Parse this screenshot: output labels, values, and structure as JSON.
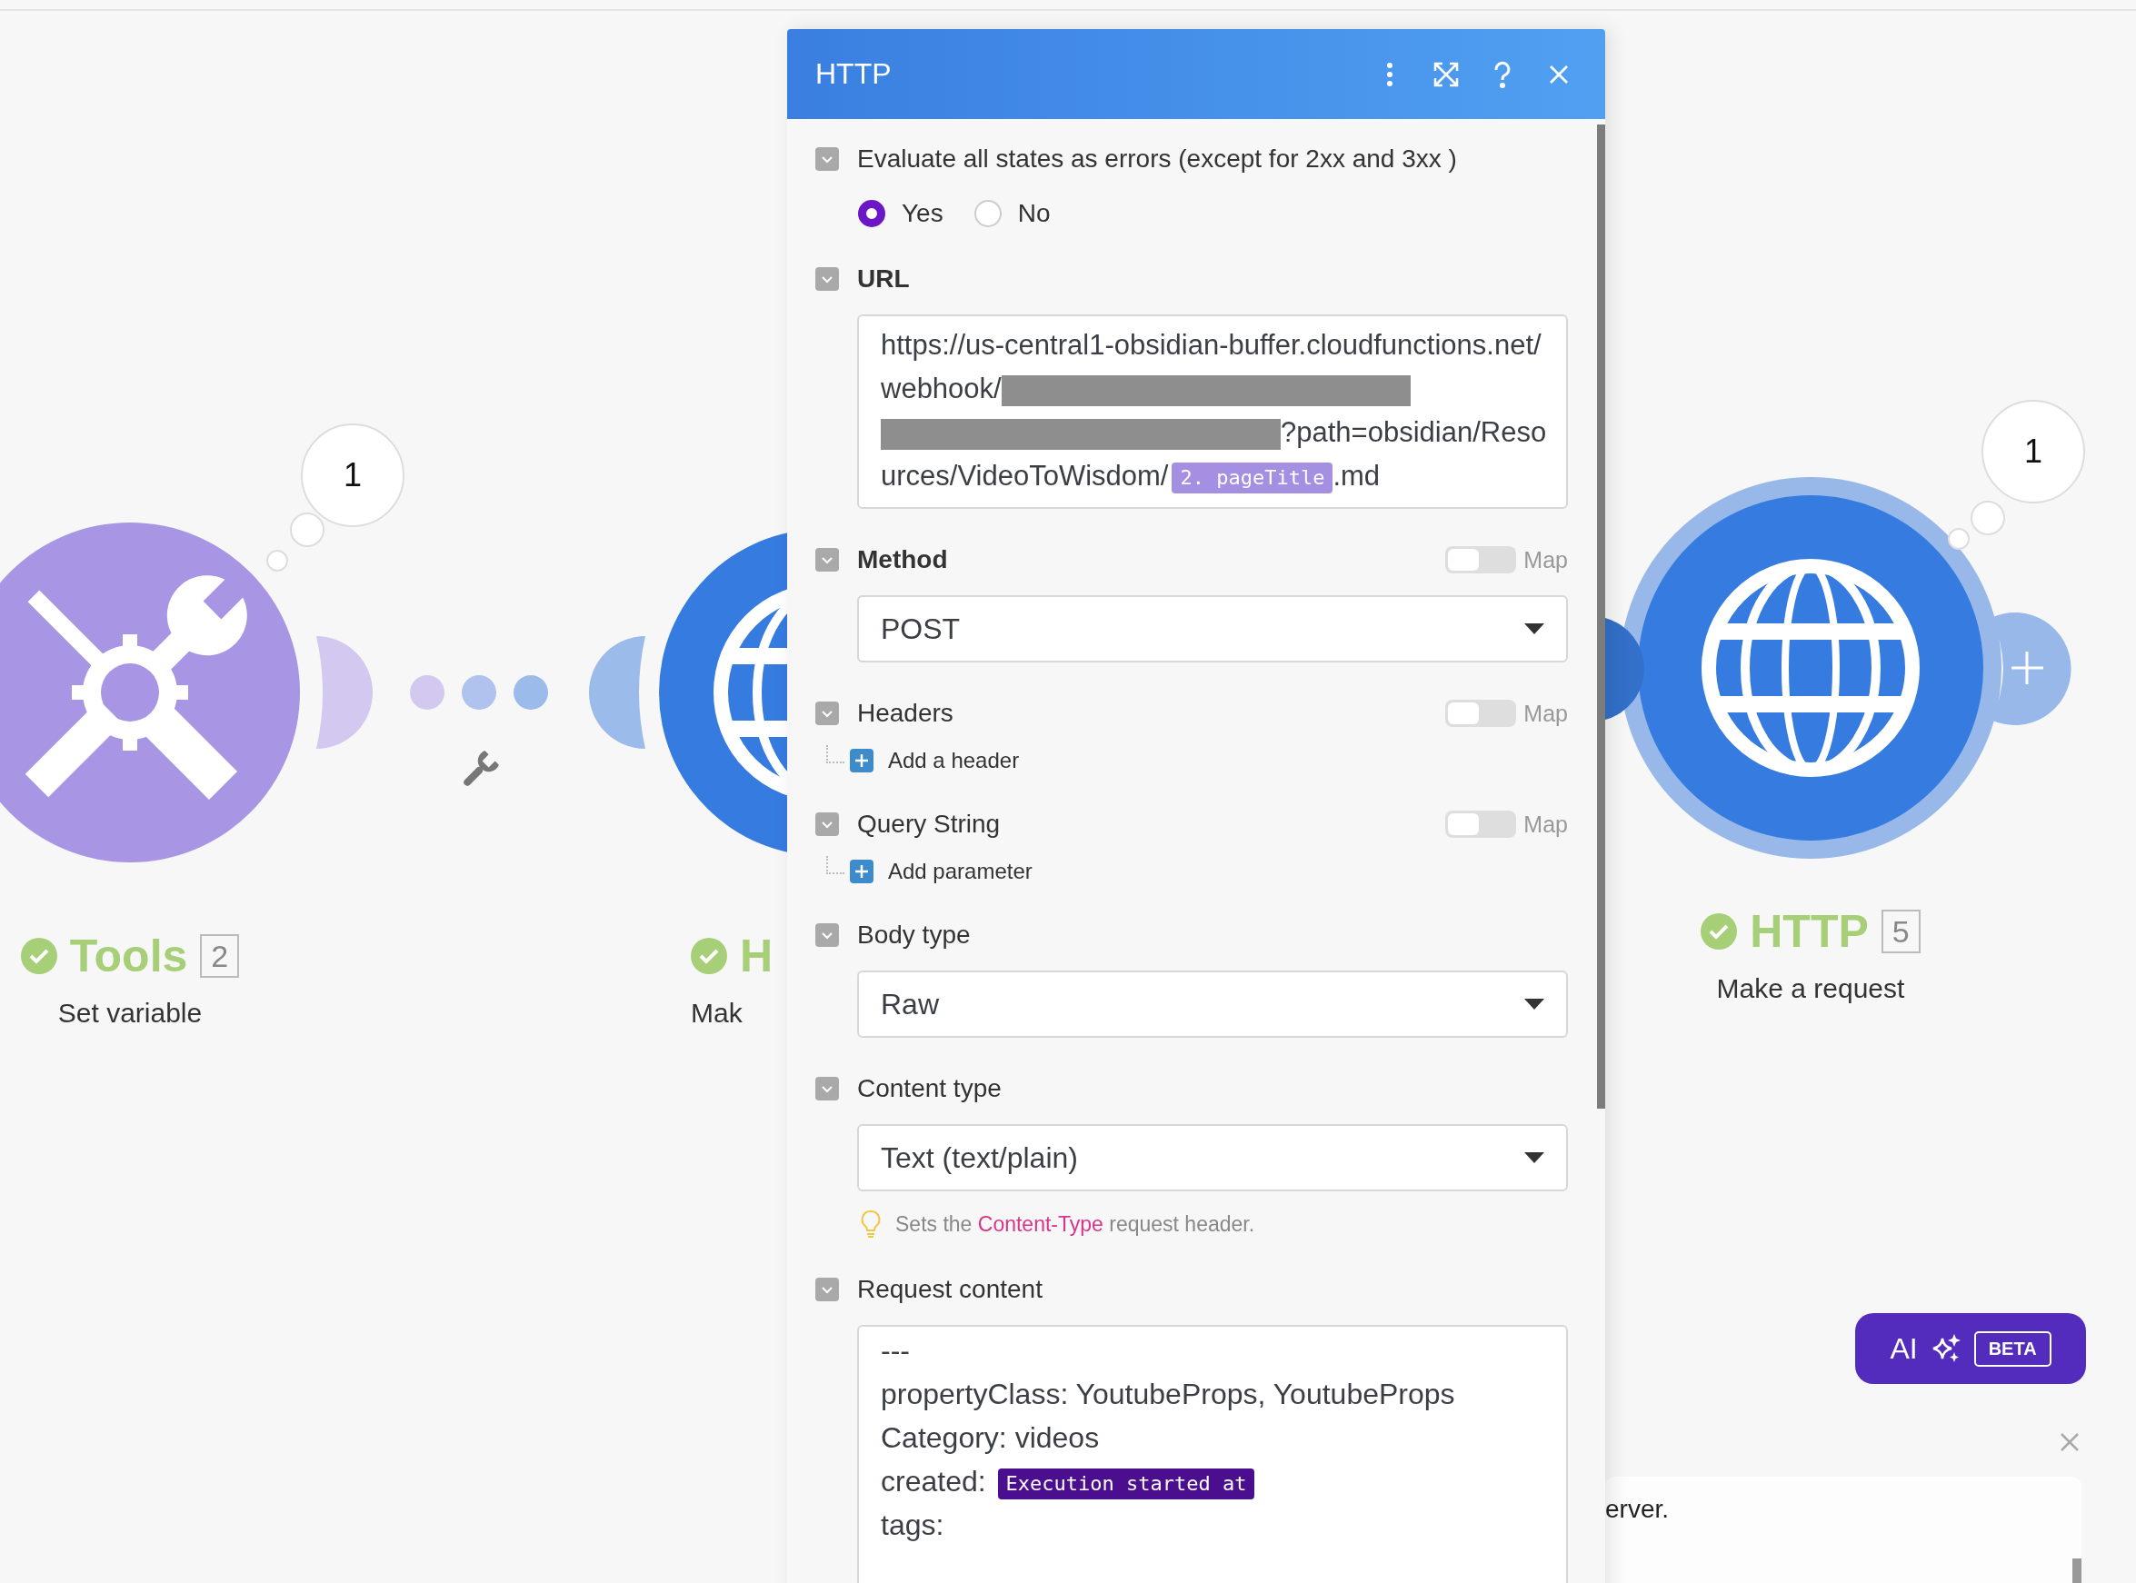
{
  "canvas": {
    "nodes": [
      {
        "kind": "tools",
        "title": "Tools",
        "count": "2",
        "subtitle": "Set variable",
        "bubble": "1"
      },
      {
        "kind": "http",
        "title": "H",
        "subtitle": "Mak"
      },
      {
        "kind": "http",
        "title": "HTTP",
        "count": "5",
        "subtitle": "Make a request",
        "bubble": "1"
      }
    ],
    "ai_button": {
      "label": "AI",
      "badge": "BETA"
    },
    "notice": {
      "text": "erver."
    }
  },
  "panel": {
    "title": "HTTP",
    "fields": [
      {
        "kind": "radio",
        "label": "Evaluate all states as errors (except for 2xx and 3xx )",
        "options": [
          {
            "label": "Yes",
            "selected": true
          },
          {
            "label": "No",
            "selected": false
          }
        ]
      },
      {
        "kind": "mapped",
        "label": "URL",
        "bold": true,
        "segments": [
          {
            "kind": "text",
            "text": "https://us-central1-obsidian-buffer.cloudfunctions.net/webhook/"
          },
          {
            "kind": "redacted"
          },
          {
            "kind": "text",
            "text": "?path=obsidian/Resources/VideoToWisdom/"
          },
          {
            "kind": "pill",
            "text": "2. pageTitle",
            "color": "#a58fe3"
          },
          {
            "kind": "text",
            "text": ".md"
          }
        ]
      },
      {
        "kind": "select",
        "label": "Method",
        "bold": true,
        "map": {
          "label": "Map",
          "on": false
        },
        "value": "POST"
      },
      {
        "kind": "list",
        "label": "Headers",
        "map": {
          "label": "Map",
          "on": false
        },
        "add": "Add a header"
      },
      {
        "kind": "list",
        "label": "Query String",
        "map": {
          "label": "Map",
          "on": false
        },
        "add": "Add parameter"
      },
      {
        "kind": "select",
        "label": "Body type",
        "value": "Raw"
      },
      {
        "kind": "select",
        "label": "Content type",
        "value": "Text (text/plain)",
        "hint": [
          {
            "kind": "text",
            "text": "Sets the "
          },
          {
            "kind": "code",
            "text": "Content-Type"
          },
          {
            "kind": "text",
            "text": " request header."
          }
        ]
      },
      {
        "kind": "textarea",
        "label": "Request content",
        "lines": [
          [
            {
              "kind": "text",
              "text": "---"
            }
          ],
          [
            {
              "kind": "text",
              "text": "propertyClass: YoutubeProps, YoutubeProps"
            }
          ],
          [
            {
              "kind": "text",
              "text": "Category: videos"
            }
          ],
          [
            {
              "kind": "text",
              "text": "created: "
            },
            {
              "kind": "pill",
              "text": "Execution started at",
              "color": "#4a0e8f"
            }
          ],
          [
            {
              "kind": "text",
              "text": "tags:"
            }
          ]
        ]
      }
    ]
  }
}
